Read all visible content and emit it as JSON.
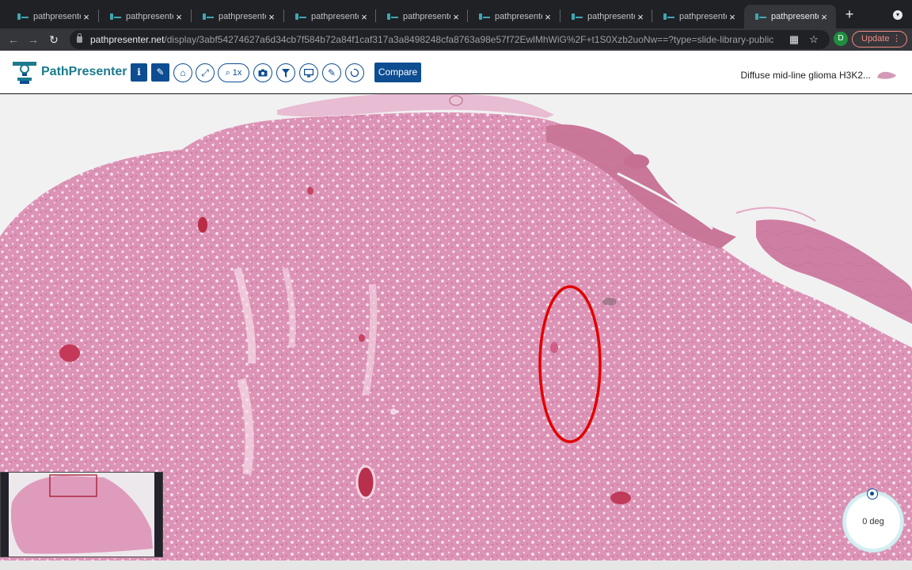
{
  "browser": {
    "tabs": [
      {
        "title": "pathpresenter.net"
      },
      {
        "title": "pathpresenter.net"
      },
      {
        "title": "pathpresenter.net"
      },
      {
        "title": "pathpresenter.net"
      },
      {
        "title": "pathpresenter.net"
      },
      {
        "title": "pathpresenter.net"
      },
      {
        "title": "pathpresenter.net"
      },
      {
        "title": "pathpresenter.net"
      },
      {
        "title": "pathpresenter.net"
      }
    ],
    "close_glyph": "×",
    "new_tab_glyph": "+",
    "url_host": "pathpresenter.net",
    "url_path": "/display/3abf54274627a6d34cb7f584b72a84f1caf317a3a8498248cfa8763a98e57f72EwlMhWiG%2F+t1S0Xzb2uoNw==?type=slide-library-public",
    "profile_initial": "D",
    "update_label": "Update",
    "menu_glyph": "⋮"
  },
  "app": {
    "brand": "PathPresenter",
    "zoom_label": "1x",
    "compare_label": "Compare",
    "slide_title": "Diffuse mid-line glioma H3K2...",
    "toolbar_icons": {
      "info": "info-icon",
      "attach": "paperclip-icon",
      "home": "home-icon",
      "fullscreen": "expand-icon",
      "zoom": "zoom-icon",
      "snapshot": "camera-icon",
      "filter": "filter-icon",
      "presentation": "monitor-icon",
      "annotate": "pencil-icon",
      "freehand": "lasso-icon"
    }
  },
  "viewer": {
    "rotation_label": "0 deg",
    "annotation_color": "#e00000"
  },
  "colors": {
    "brand_blue": "#0d4d92",
    "brand_teal": "#1b7a8c",
    "tissue_pink": "#dc93b5",
    "background": "#f1f1f2"
  }
}
